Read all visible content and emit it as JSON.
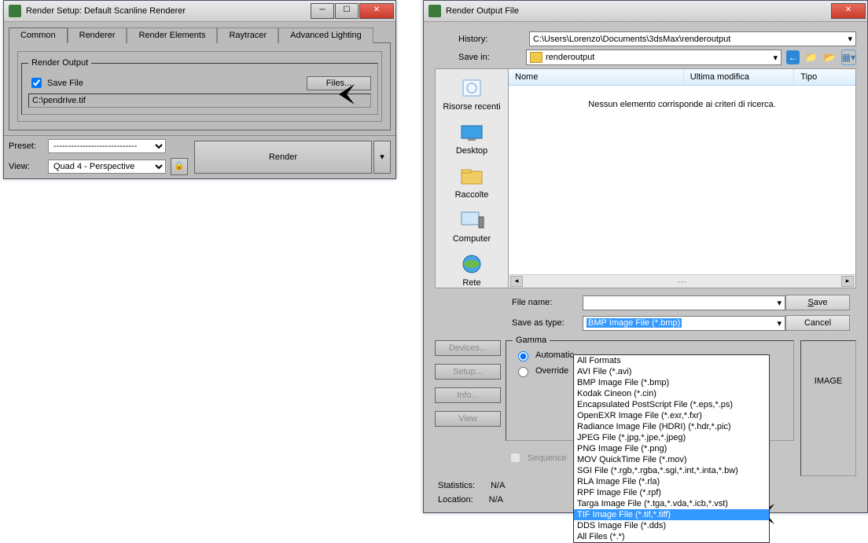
{
  "render_setup": {
    "title": "Render Setup: Default Scanline Renderer",
    "tabs": {
      "common": "Common",
      "renderer": "Renderer",
      "render_elements": "Render Elements",
      "raytracer": "Raytracer",
      "advanced_lighting": "Advanced Lighting"
    },
    "fieldset_title": "Render Output",
    "save_file_label": "Save File",
    "files_button": "Files...",
    "output_path": "C:\\pendrive.tif",
    "preset_label": "Preset:",
    "preset_value": "-----------------------------",
    "view_label": "View:",
    "view_value": "Quad 4 - Perspective",
    "render_button": "Render"
  },
  "output_dialog": {
    "title": "Render Output File",
    "winbtn_help": "?",
    "winbtn_close": "✕",
    "history_label": "History:",
    "history_value": "C:\\Users\\Lorenzo\\Documents\\3dsMax\\renderoutput",
    "savein_label": "Save in:",
    "savein_value": "renderoutput",
    "columns": {
      "name": "Nome",
      "date": "Ultima modifica",
      "type": "Tipo"
    },
    "empty_msg": "Nessun elemento corrisponde ai criteri di ricerca.",
    "places": {
      "recent": "Risorse recenti",
      "desktop": "Desktop",
      "collections": "Raccolte",
      "computer": "Computer",
      "network": "Rete"
    },
    "file_name_label": "File name:",
    "file_name_value": "",
    "save_as_label": "Save as type:",
    "save_as_value": "BMP Image File (*.bmp)",
    "save_btn": "Save",
    "cancel_btn": "Cancel",
    "type_options": [
      "All Formats",
      "AVI File (*.avi)",
      "BMP Image File (*.bmp)",
      "Kodak Cineon (*.cin)",
      "Encapsulated PostScript File (*.eps,*.ps)",
      "OpenEXR Image File (*.exr,*.fxr)",
      "Radiance Image File (HDRI) (*.hdr,*.pic)",
      "JPEG File (*.jpg,*.jpe,*.jpeg)",
      "PNG Image File (*.png)",
      "MOV QuickTime File (*.mov)",
      "SGI File (*.rgb,*.rgba,*.sgi,*.int,*.inta,*.bw)",
      "RLA Image File (*.rla)",
      "RPF Image File (*.rpf)",
      "Targa Image File (*.tga,*.vda,*.icb,*.vst)",
      "TIF Image File (*.tif,*.tiff)",
      "DDS Image File (*.dds)",
      "All Files (*.*)"
    ],
    "selected_type_index": 14,
    "left_buttons": {
      "devices": "Devices...",
      "setup": "Setup...",
      "info": "Info...",
      "view": "View"
    },
    "gamma_title": "Gamma",
    "gamma_auto": "Automatic",
    "gamma_override": "Override",
    "sequence_label": "Sequence",
    "preview_placeholder": "IMAGE",
    "stats_label": "Statistics:",
    "stats_value": "N/A",
    "loc_label": "Location:",
    "loc_value": "N/A"
  }
}
